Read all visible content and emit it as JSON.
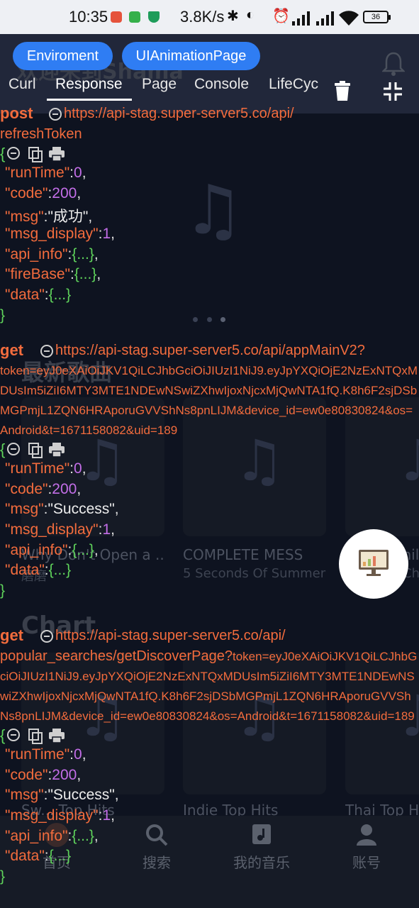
{
  "status_bar": {
    "time": "10:35",
    "speed": "3.8K/s",
    "battery": "36"
  },
  "background": {
    "welcome": "欢迎来到Shama",
    "section_new": "最新歌曲",
    "section_chart": "Chart",
    "songs": [
      {
        "title": "Why Don't Open a ...",
        "artist": "磨磨"
      },
      {
        "title": "COMPLETE MESS",
        "artist": "5 Seconds Of Summer"
      },
      {
        "title": "Smil",
        "artist": "Ch"
      }
    ],
    "charts": [
      "Sw... Top Hits",
      "Indie Top Hits",
      "Thai Top Hit"
    ],
    "nav": [
      "首页",
      "搜索",
      "我的音乐",
      "账号"
    ]
  },
  "overlay": {
    "buttons": [
      "Enviroment",
      "UIAnimationPage"
    ],
    "tabs": [
      "Curl",
      "Response",
      "Page",
      "Console",
      "LifeCyc"
    ],
    "active_tab": "Response"
  },
  "log": [
    {
      "method": "post",
      "base": "https://api-stag.super-server5.co",
      "path": "/api/",
      "path2": "refreshToken",
      "query": "",
      "fields": [
        {
          "key": "runTime",
          "value": "0",
          "type": "num"
        },
        {
          "key": "code",
          "value": "200",
          "type": "num"
        },
        {
          "key": "msg",
          "value": "\"成功\"",
          "type": "str"
        },
        {
          "key": "msg_display",
          "value": "1",
          "type": "num"
        },
        {
          "key": "api_info",
          "value": "{...}",
          "type": "obj"
        },
        {
          "key": "fireBase",
          "value": "{...}",
          "type": "obj"
        },
        {
          "key": "data",
          "value": "{...}",
          "type": "obj"
        }
      ]
    },
    {
      "method": "get",
      "base": "https://api-stag.super-server5.co",
      "path": "/api/appMainV2?",
      "path2": "",
      "query": "token=eyJ0eXAiOiJKV1QiLCJhbGciOiJIUzI1NiJ9.eyJpYXQiOjE2NzExNTQxMDUsIm5iZiI6MTY3MTE1NDEwNSwiZXhwIjoxNjcxMjQwNTA1fQ.K8h6F2sjDSbMGPmjL1ZQN6HRAporuGVVShNs8pnLIJM&device_id=ew0e80830824&os=Android&t=1671158082&uid=189",
      "fields": [
        {
          "key": "runTime",
          "value": "0",
          "type": "num"
        },
        {
          "key": "code",
          "value": "200",
          "type": "num"
        },
        {
          "key": "msg",
          "value": "\"Success\"",
          "type": "str"
        },
        {
          "key": "msg_display",
          "value": "1",
          "type": "num"
        },
        {
          "key": "api_info",
          "value": "{...}",
          "type": "obj"
        },
        {
          "key": "data",
          "value": "{...}",
          "type": "obj"
        }
      ]
    },
    {
      "method": "get",
      "base": "https://api-stag.super-server5.co",
      "path": "/api/",
      "path2": "popular_searches/getDiscoverPage?",
      "query": "token=eyJ0eXAiOiJKV1QiLCJhbGciOiJIUzI1NiJ9.eyJpYXQiOjE2NzExNTQxMDUsIm5iZiI6MTY3MTE1NDEwNSwiZXhwIjoxNjcxMjQwNTA1fQ.K8h6F2sjDSbMGPmjL1ZQN6HRAporuGVVShNs8pnLIJM&device_id=ew0e80830824&os=Android&t=1671158082&uid=189",
      "fields": [
        {
          "key": "runTime",
          "value": "0",
          "type": "num"
        },
        {
          "key": "code",
          "value": "200",
          "type": "num"
        },
        {
          "key": "msg",
          "value": "\"Success\"",
          "type": "str"
        },
        {
          "key": "msg_display",
          "value": "1",
          "type": "num"
        },
        {
          "key": "api_info",
          "value": "{...}",
          "type": "obj"
        },
        {
          "key": "data",
          "value": "{...}",
          "type": "obj"
        }
      ]
    }
  ]
}
